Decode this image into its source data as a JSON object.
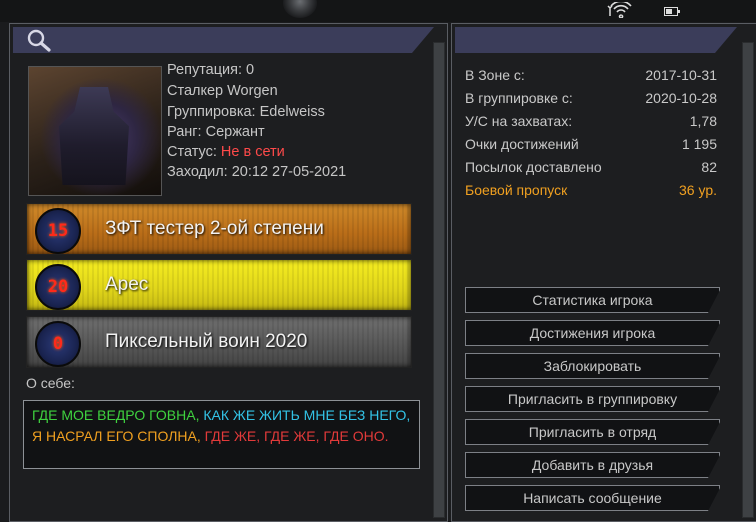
{
  "left_panel": {
    "search_icon": "search-icon",
    "profile": {
      "reputation": "Репутация: 0",
      "stalker": "Сталкер Worgen",
      "faction": "Группировка: Edelweiss",
      "rank": "Ранг: Сержант",
      "status_label": "Статус:",
      "status_value": "Не в сети",
      "last_seen": "Заходил: 20:12 27-05-2021"
    },
    "badges": [
      {
        "number": "15",
        "label": "ЗФТ тестер 2-ой степени",
        "color": "#c67a22"
      },
      {
        "number": "20",
        "label": "Арес",
        "color": "#efe31e"
      },
      {
        "number": "0",
        "label": "Пиксельный воин 2020",
        "color": "#606060"
      }
    ],
    "about_label": "О себе:",
    "about_parts": [
      {
        "text": "ГДЕ МОЕ ВЕДРО ГОВНА,",
        "color": "#3fd23f"
      },
      {
        "text": "КАК ЖЕ ЖИТЬ МНЕ БЕЗ НЕГО,",
        "color": "#33c3e6"
      },
      {
        "text": "Я НАСРАЛ ЕГО СПОЛНА,",
        "color": "#f0a020"
      },
      {
        "text": "ГДЕ ЖЕ, ГДЕ ЖЕ, ГДЕ ОНО.",
        "color": "#e23a3a"
      }
    ]
  },
  "right_panel": {
    "stats": [
      {
        "label": "В Зоне с:",
        "value": "2017-10-31"
      },
      {
        "label": "В группировке с:",
        "value": "2020-10-28"
      },
      {
        "label": "У/С на захватах:",
        "value": "1,78"
      },
      {
        "label": "Очки достижений",
        "value": "1 195"
      },
      {
        "label": "Посылок доставлено",
        "value": "82"
      },
      {
        "label": "Боевой пропуск",
        "value": "36 ур.",
        "highlight": "#f0a020"
      }
    ],
    "buttons": [
      "Статистика игрока",
      "Достижения игрока",
      "Заблокировать",
      "Пригласить в группировку",
      "Пригласить в отряд",
      "Добавить в друзья",
      "Написать сообщение"
    ]
  }
}
